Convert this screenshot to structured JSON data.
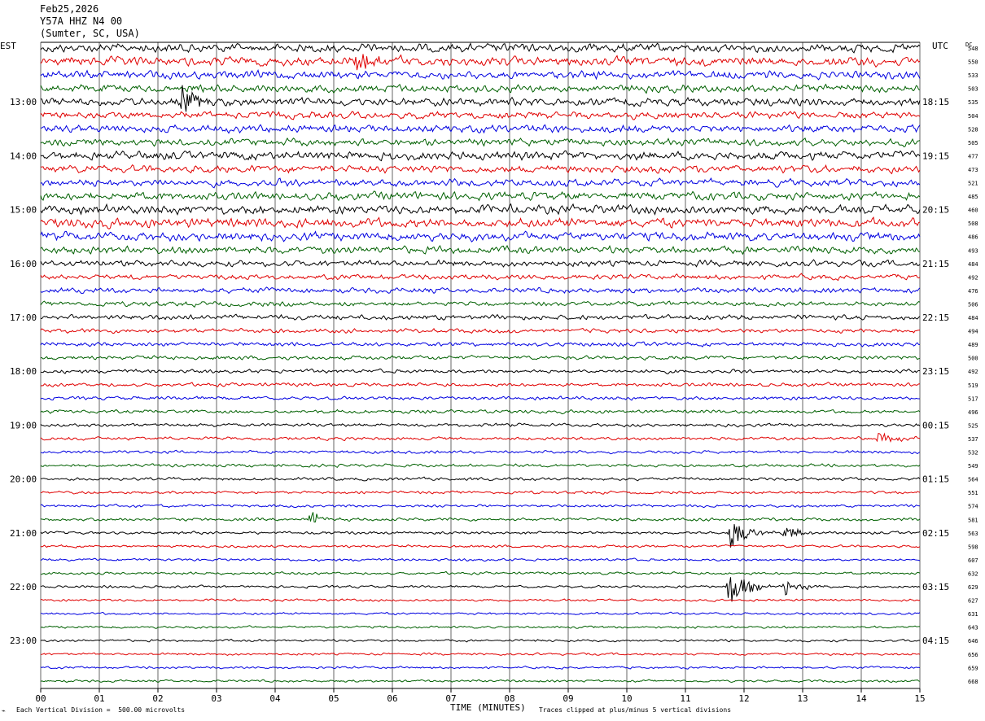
{
  "header": {
    "date": "Feb25,2026",
    "station": "Y57A HHZ N4 00",
    "location": "(Sumter, SC, USA)"
  },
  "left_axis_label": "EST",
  "right_axis_label": "UTC",
  "dc_label": "DC",
  "x_axis_label": "TIME (MINUTES)",
  "footer": {
    "scale_note": "Each Vertical Division =  500.00 microvolts",
    "clip_note": "Traces clipped at plus/minus 5 vertical divisions"
  },
  "colors": {
    "trace_cycle": [
      "#000000",
      "#e00000",
      "#0000e0",
      "#006000"
    ],
    "grid": "#000000"
  },
  "chart_data": {
    "type": "helicorder",
    "x_ticks": [
      "00",
      "01",
      "02",
      "03",
      "04",
      "05",
      "06",
      "07",
      "08",
      "09",
      "10",
      "11",
      "12",
      "13",
      "14",
      "15"
    ],
    "xlim": [
      0,
      15
    ],
    "left_hour_labels": [
      "13:00",
      "14:00",
      "15:00",
      "16:00",
      "17:00",
      "18:00",
      "19:00",
      "20:00",
      "21:00",
      "22:00",
      "23:00"
    ],
    "right_hour_labels": [
      "18:15",
      "19:15",
      "20:15",
      "21:15",
      "22:15",
      "23:15",
      "00:15",
      "01:15",
      "02:15",
      "03:15",
      "04:15"
    ],
    "dc_offsets": [
      548,
      550,
      533,
      503,
      535,
      504,
      528,
      505,
      477,
      473,
      521,
      485,
      460,
      508,
      486,
      493,
      484,
      492,
      476,
      506,
      484,
      494,
      489,
      500,
      492,
      519,
      517,
      496,
      525,
      537,
      532,
      549,
      564,
      551,
      574,
      581,
      563,
      598,
      607,
      632,
      629,
      627,
      631,
      643,
      646,
      656,
      659,
      668
    ],
    "noise_levels": [
      1.8,
      1.9,
      1.7,
      1.6,
      1.7,
      1.5,
      1.6,
      1.5,
      1.8,
      1.6,
      1.6,
      1.7,
      1.9,
      2.0,
      1.8,
      1.6,
      1.3,
      1.1,
      1.1,
      1.0,
      1.1,
      0.9,
      0.9,
      0.85,
      0.8,
      0.75,
      0.75,
      0.75,
      0.7,
      0.7,
      0.65,
      0.65,
      0.65,
      0.6,
      0.6,
      0.65,
      0.6,
      0.55,
      0.55,
      0.55,
      0.55,
      0.5,
      0.5,
      0.5,
      0.5,
      0.5,
      0.5,
      0.5
    ],
    "events": [
      {
        "row": 1,
        "minute": 5.4,
        "amplitude": 3.5
      },
      {
        "row": 4,
        "minute": 2.4,
        "amplitude": 4.0
      },
      {
        "row": 36,
        "minute": 11.75,
        "amplitude": 4.5
      },
      {
        "row": 36,
        "minute": 12.7,
        "amplitude": 2.0
      },
      {
        "row": 40,
        "minute": 11.75,
        "amplitude": 5.0
      },
      {
        "row": 40,
        "minute": 12.7,
        "amplitude": 2.5
      },
      {
        "row": 35,
        "minute": 4.6,
        "amplitude": 1.8
      },
      {
        "row": 29,
        "minute": 14.3,
        "amplitude": 1.6
      }
    ]
  }
}
